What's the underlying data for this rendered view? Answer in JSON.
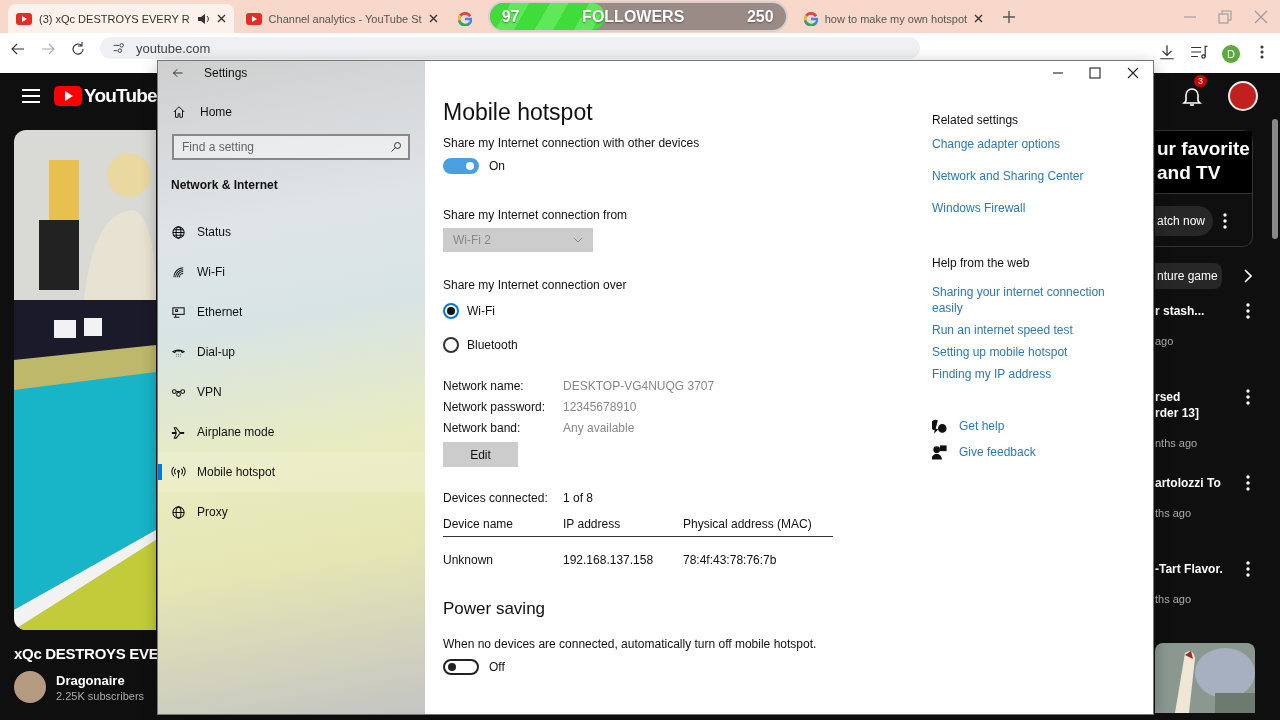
{
  "browser": {
    "tabs": [
      {
        "title": "(3) xQc DESTROYS EVERY R",
        "kind": "youtube",
        "selected": true,
        "playing_audio": true
      },
      {
        "title": "Channel analytics - YouTube St",
        "kind": "youtube",
        "selected": false,
        "playing_audio": false
      },
      {
        "kind": "google",
        "selected": false,
        "playing_audio": false
      },
      {
        "title": "how to make my own hotspot",
        "kind": "google",
        "selected": false,
        "playing_audio": false
      }
    ],
    "url": "youtube.com",
    "profile_initial": "D"
  },
  "stream_overlay": {
    "current": "97",
    "label": "FOLLOWERS",
    "goal": "250",
    "level": 0.39
  },
  "youtube": {
    "logo": "YouTube",
    "notifications": "3",
    "video_title": "xQc DESTROYS EVE",
    "channel": "Dragonaire",
    "subscribers": "2.25K subscribers",
    "promo": {
      "lines": [
        "ur favorite",
        "and TV"
      ],
      "button": "atch now"
    },
    "chip": "nture game",
    "videos": [
      {
        "title_lines": [
          "r stash..."
        ],
        "meta": "ago"
      },
      {
        "title_lines": [
          "rsed",
          "rder 13]"
        ],
        "meta": "nths ago"
      },
      {
        "title_lines": [
          "artolozzi To"
        ],
        "meta": "ths ago"
      },
      {
        "title_lines": [
          "-Tart Flavor."
        ],
        "meta": "ths ago"
      }
    ]
  },
  "settings": {
    "title": "Settings",
    "nav": {
      "home": "Home",
      "search_placeholder": "Find a setting",
      "section": "Network & Internet",
      "items": [
        {
          "label": "Status",
          "selected": false
        },
        {
          "label": "Wi-Fi",
          "selected": false
        },
        {
          "label": "Ethernet",
          "selected": false
        },
        {
          "label": "Dial-up",
          "selected": false
        },
        {
          "label": "VPN",
          "selected": false
        },
        {
          "label": "Airplane mode",
          "selected": false
        },
        {
          "label": "Mobile hotspot",
          "selected": true
        },
        {
          "label": "Proxy",
          "selected": false
        }
      ]
    },
    "page": {
      "title": "Mobile hotspot",
      "share": {
        "label": "Share my Internet connection with other devices",
        "on": true,
        "state_text": "On"
      },
      "from": {
        "label": "Share my Internet connection from",
        "value": "Wi-Fi 2",
        "disabled": true
      },
      "over": {
        "label": "Share my Internet connection over",
        "options": [
          {
            "label": "Wi-Fi",
            "selected": true
          },
          {
            "label": "Bluetooth",
            "selected": false
          }
        ]
      },
      "details": [
        {
          "label": "Network name:",
          "value": "DESKTOP-VG4NUQG 3707"
        },
        {
          "label": "Network password:",
          "value": "12345678910"
        },
        {
          "label": "Network band:",
          "value": "Any available"
        }
      ],
      "edit_button": "Edit",
      "devices": {
        "label": "Devices connected:",
        "value": "1 of 8",
        "columns": [
          "Device name",
          "IP address",
          "Physical address (MAC)"
        ],
        "rows": [
          [
            "Unknown",
            "192.168.137.158",
            "78:4f:43:78:76:7b"
          ]
        ]
      },
      "power_saving": {
        "title": "Power saving",
        "description": "When no devices are connected, automatically turn off mobile hotspot.",
        "on": false,
        "state_text": "Off"
      }
    },
    "related": {
      "title": "Related settings",
      "links": [
        "Change adapter options",
        "Network and Sharing Center",
        "Windows Firewall"
      ]
    },
    "help": {
      "title": "Help from the web",
      "links": [
        "Sharing your internet connection easily",
        "Run an internet speed test",
        "Setting up mobile hotspot",
        "Finding my IP address"
      ]
    },
    "support": [
      {
        "label": "Get help",
        "kind": "help"
      },
      {
        "label": "Give feedback",
        "kind": "feedback"
      }
    ]
  }
}
